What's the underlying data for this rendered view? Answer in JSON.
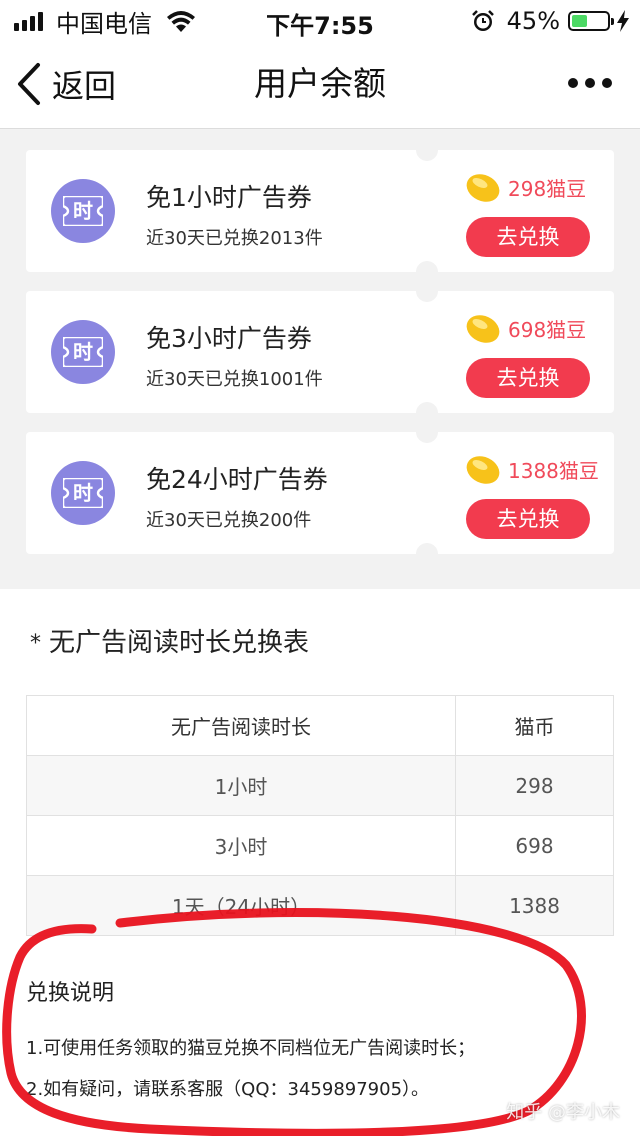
{
  "status_bar": {
    "carrier": "中国电信",
    "time": "下午7:55",
    "battery_percent": "45%",
    "battery_level": 0.45,
    "icons": [
      "signal-icon",
      "wifi-icon",
      "alarm-icon",
      "battery-icon",
      "charging-bolt-icon"
    ]
  },
  "nav": {
    "back_label": "返回",
    "title": "用户余额",
    "more_icon": "more-dots-icon"
  },
  "coupons": [
    {
      "icon_glyph": "时",
      "title": "免1小时广告券",
      "subtitle": "近30天已兑换2013件",
      "price": "298猫豆",
      "button": "去兑换"
    },
    {
      "icon_glyph": "时",
      "title": "免3小时广告券",
      "subtitle": "近30天已兑换1001件",
      "price": "698猫豆",
      "button": "去兑换"
    },
    {
      "icon_glyph": "时",
      "title": "免24小时广告券",
      "subtitle": "近30天已兑换200件",
      "price": "1388猫豆",
      "button": "去兑换"
    }
  ],
  "table": {
    "star": "*",
    "title": "无广告阅读时长兑换表",
    "headers": [
      "无广告阅读时长",
      "猫币"
    ],
    "rows": [
      [
        "1小时",
        "298"
      ],
      [
        "3小时",
        "698"
      ],
      [
        "1天（24小时）",
        "1388"
      ]
    ]
  },
  "notes": {
    "title": "兑换说明",
    "items": [
      "1.可使用任务领取的猫豆兑换不同档位无广告阅读时长；",
      "2.如有疑问，请联系客服（QQ：3459897905）。"
    ]
  },
  "watermark": "知乎 @李小木",
  "colors": {
    "accent_red": "#f23b4e",
    "price_red": "#f04a5a",
    "icon_purple": "#8a86e0",
    "bean_yellow": "#f7c21a",
    "annotation_red": "#e8121e"
  }
}
